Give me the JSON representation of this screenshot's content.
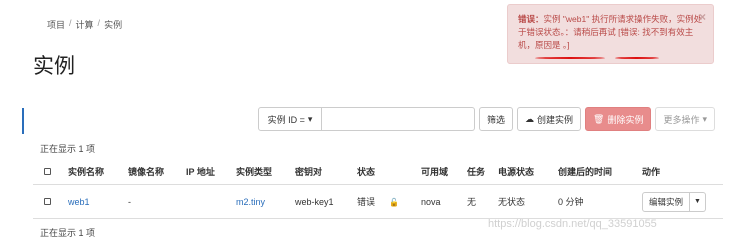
{
  "breadcrumb": [
    "项目",
    "计算",
    "实例"
  ],
  "page_title": "实例",
  "toolbar": {
    "filter_label": "实例 ID =",
    "filter_value": "",
    "filter_button": "筛选",
    "create_button": "创建实例",
    "delete_button": "删除实例",
    "more_button": "更多操作"
  },
  "count_text": "正在显示 1 项",
  "table": {
    "headers": [
      "实例名称",
      "镜像名称",
      "IP 地址",
      "实例类型",
      "密钥对",
      "状态",
      "可用域",
      "任务",
      "电源状态",
      "创建后的时间",
      "动作"
    ],
    "rows": [
      {
        "name": "web1",
        "image": "-",
        "ip": "",
        "flavor": "m2.tiny",
        "keypair": "web-key1",
        "status": "错误",
        "az": "nova",
        "task": "无",
        "power": "无状态",
        "age": "0 分钟",
        "action": "编辑实例"
      }
    ]
  },
  "alert": {
    "title": "错误：",
    "message": "实例 \"web1\" 执行所请求操作失败，实例处于错误状态。：请稍后再试 [错误: 找不到有效主机，原因是 。]",
    "colors": {
      "bg": "#f2dede",
      "text": "#b94a48"
    }
  },
  "watermark": "https://blog.csdn.net/qq_33591055",
  "colors": {
    "link": "#2a6ebb",
    "danger": "#e88c8c"
  }
}
